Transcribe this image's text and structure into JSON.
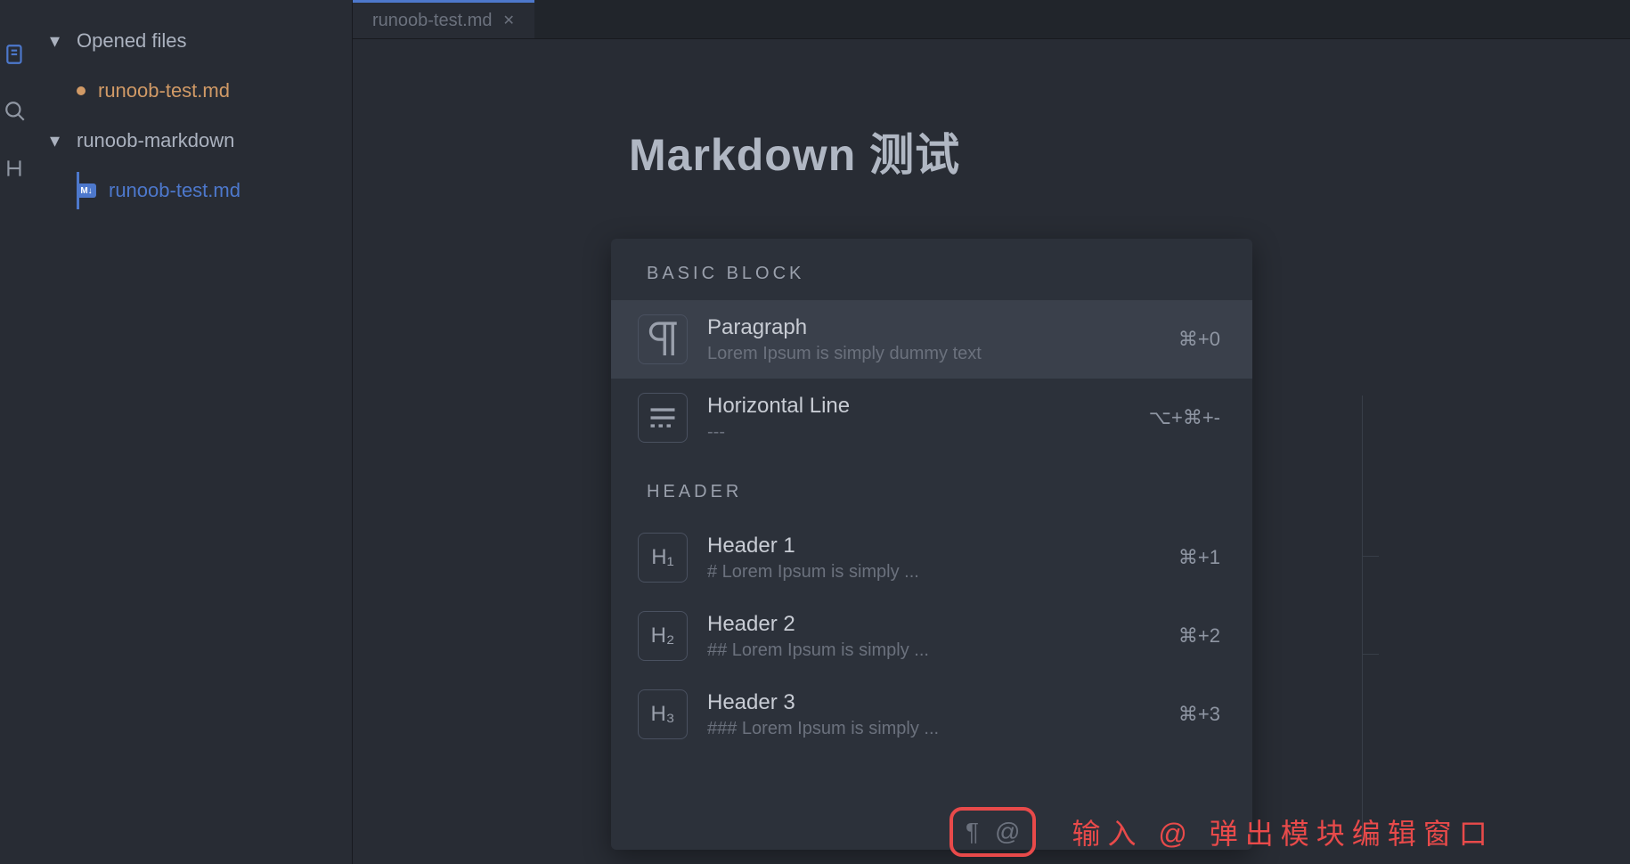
{
  "sidebar": {
    "opened_files_label": "Opened files",
    "opened_files": [
      {
        "name": "runoob-test.md",
        "modified": true
      }
    ],
    "folder_label": "runoob-markdown",
    "folder_files": [
      {
        "name": "runoob-test.md",
        "active": true
      }
    ]
  },
  "tabs": [
    {
      "label": "runoob-test.md",
      "active": true
    }
  ],
  "document": {
    "title": "Markdown 测试"
  },
  "popup": {
    "sections": [
      {
        "title": "BASIC BLOCK",
        "items": [
          {
            "icon": "¶",
            "title": "Paragraph",
            "desc": "Lorem Ipsum is simply dummy text",
            "shortcut": "⌘+0",
            "selected": true
          },
          {
            "icon": "hr",
            "title": "Horizontal Line",
            "desc": "---",
            "shortcut": "⌥+⌘+-"
          }
        ]
      },
      {
        "title": "HEADER",
        "items": [
          {
            "icon": "H₁",
            "title": "Header 1",
            "desc": "# Lorem Ipsum is simply ...",
            "shortcut": "⌘+1"
          },
          {
            "icon": "H₂",
            "title": "Header 2",
            "desc": "## Lorem Ipsum is simply ...",
            "shortcut": "⌘+2"
          },
          {
            "icon": "H₃",
            "title": "Header 3",
            "desc": "### Lorem Ipsum is simply ...",
            "shortcut": "⌘+3"
          }
        ]
      }
    ]
  },
  "bottom_toolbar": {
    "icons": [
      "¶",
      "@"
    ]
  },
  "annotation_text": "输入 @ 弹出模块编辑窗口"
}
